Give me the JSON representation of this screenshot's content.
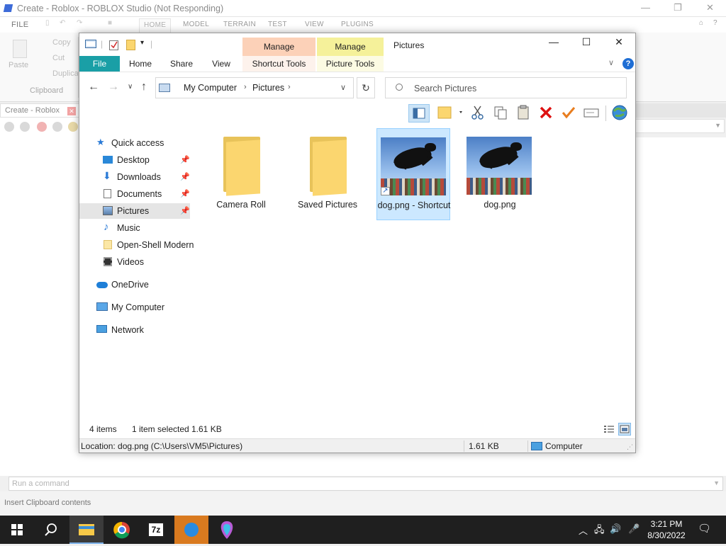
{
  "studio": {
    "title": "Create - Roblox - ROBLOX Studio (Not Responding)",
    "menu": [
      "FILE",
      "HOME",
      "MODEL",
      "TERRAIN",
      "TEST",
      "VIEW",
      "PLUGINS"
    ],
    "paste_label": "Paste",
    "copy_label": "Copy",
    "cut_label": "Cut",
    "duplicate_label": "Duplica",
    "clipboard_group": "Clipboard",
    "doc_tab": "Create - Roblox",
    "command_placeholder": "Run a command",
    "status_text": "Insert Clipboard contents"
  },
  "explorer": {
    "context_tabs": {
      "manage_shortcut": "Manage",
      "manage_picture": "Manage",
      "window_title": "Pictures"
    },
    "ribbon_tabs": {
      "file": "File",
      "home": "Home",
      "share": "Share",
      "view": "View",
      "shortcut_tools": "Shortcut Tools",
      "picture_tools": "Picture Tools"
    },
    "help": "?",
    "address": {
      "root": "My Computer",
      "current": "Pictures"
    },
    "search_placeholder": "Search Pictures",
    "nav": {
      "quick_access": "Quick access",
      "desktop": "Desktop",
      "downloads": "Downloads",
      "documents": "Documents",
      "pictures": "Pictures",
      "music": "Music",
      "open_shell": "Open-Shell Modern",
      "videos": "Videos",
      "onedrive": "OneDrive",
      "my_computer": "My Computer",
      "network": "Network"
    },
    "items": {
      "camera_roll": "Camera Roll",
      "saved_pictures": "Saved Pictures",
      "dog_shortcut": "dog.png - Shortcut",
      "dog_png": "dog.png"
    },
    "status": {
      "count": "4 items",
      "selected": "1 item selected",
      "size": "1.61 KB"
    },
    "location": {
      "path": "Location: dog.png (C:\\Users\\VM5\\Pictures)",
      "size": "1.61 KB",
      "zone": "Computer"
    }
  },
  "taskbar": {
    "time": "3:21 PM",
    "date": "8/30/2022",
    "seven_zip_label": "7z"
  }
}
